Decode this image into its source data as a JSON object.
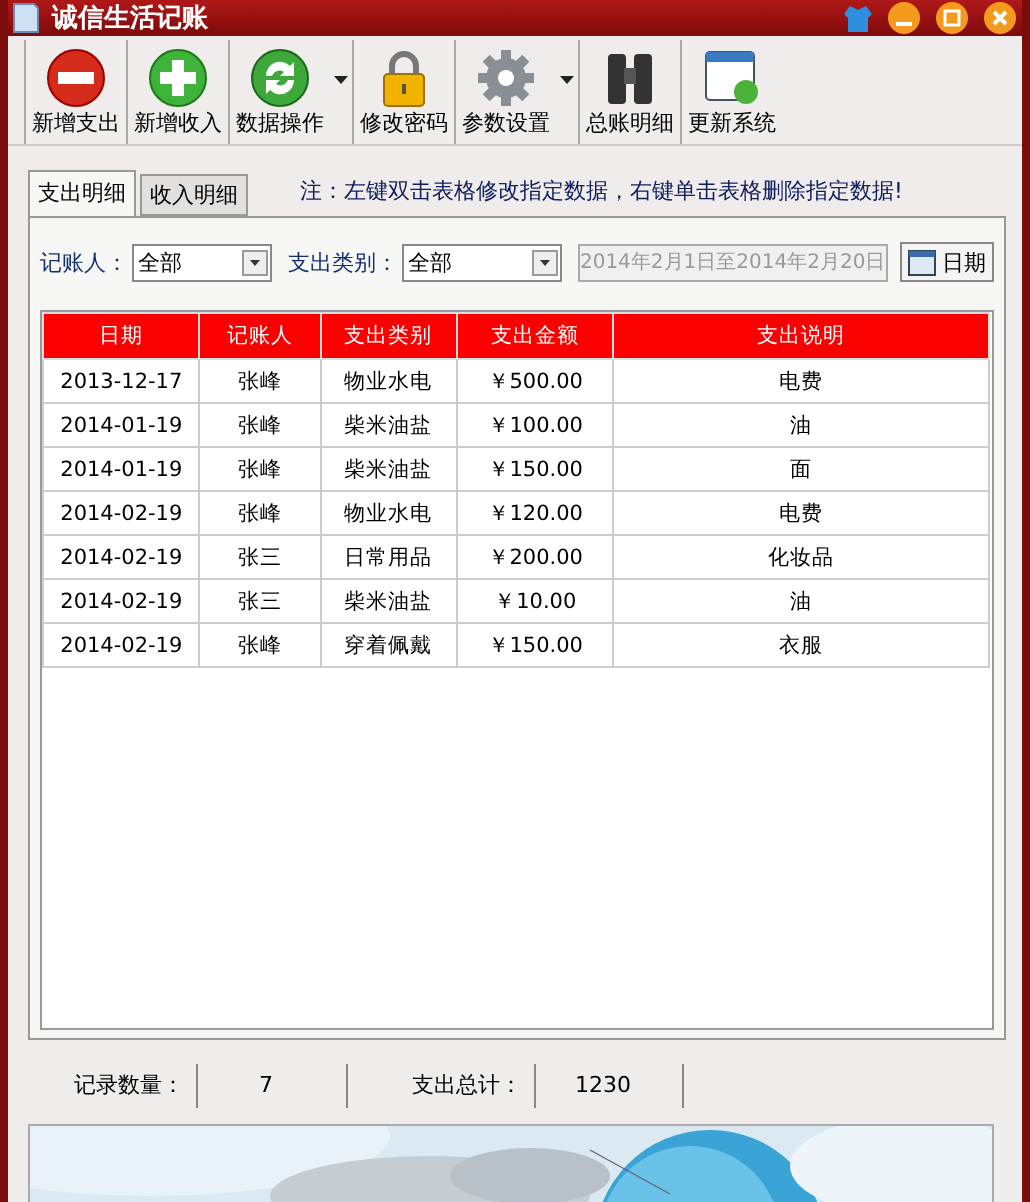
{
  "window": {
    "title": "诚信生活记账"
  },
  "toolbar": [
    {
      "label": "新增支出",
      "kind": "minus",
      "dropdown": false
    },
    {
      "label": "新增收入",
      "kind": "plus",
      "dropdown": false
    },
    {
      "label": "数据操作",
      "kind": "refresh",
      "dropdown": true
    },
    {
      "label": "修改密码",
      "kind": "lock",
      "dropdown": false
    },
    {
      "label": "参数设置",
      "kind": "gear",
      "dropdown": true
    },
    {
      "label": "总账明细",
      "kind": "binoculars",
      "dropdown": false
    },
    {
      "label": "更新系统",
      "kind": "update",
      "dropdown": false
    }
  ],
  "tabs": [
    {
      "label": "支出明细",
      "selected": true
    },
    {
      "label": "收入明细",
      "selected": false
    }
  ],
  "note": "注：左键双击表格修改指定数据，右键单击表格删除指定数据!",
  "filters": {
    "person_label": "记账人：",
    "person_value": "全部",
    "category_label": "支出类别：",
    "category_value": "全部",
    "date_range": "2014年2月1日至2014年2月20日",
    "date_button": "日期"
  },
  "table": {
    "columns": [
      "日期",
      "记账人",
      "支出类别",
      "支出金额",
      "支出说明"
    ],
    "rows": [
      [
        "2013-12-17",
        "张峰",
        "物业水电",
        "￥500.00",
        "电费"
      ],
      [
        "2014-01-19",
        "张峰",
        "柴米油盐",
        "￥100.00",
        "油"
      ],
      [
        "2014-01-19",
        "张峰",
        "柴米油盐",
        "￥150.00",
        "面"
      ],
      [
        "2014-02-19",
        "张峰",
        "物业水电",
        "￥120.00",
        "电费"
      ],
      [
        "2014-02-19",
        "张三",
        "日常用品",
        "￥200.00",
        "化妆品"
      ],
      [
        "2014-02-19",
        "张三",
        "柴米油盐",
        "￥10.00",
        "油"
      ],
      [
        "2014-02-19",
        "张峰",
        "穿着佩戴",
        "￥150.00",
        "衣服"
      ]
    ]
  },
  "status_bar": {
    "count_label": "记录数量：",
    "count": "7",
    "total_label": "支出总计：",
    "total": "1230"
  }
}
